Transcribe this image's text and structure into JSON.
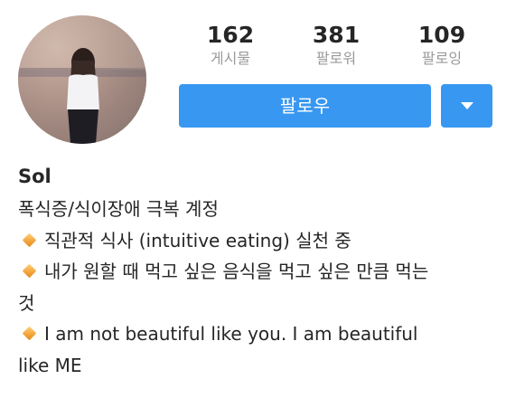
{
  "stats": [
    {
      "value": "162",
      "label": "게시물"
    },
    {
      "value": "381",
      "label": "팔로워"
    },
    {
      "value": "109",
      "label": "팔로잉"
    }
  ],
  "follow_button": "팔로우",
  "profile": {
    "name": "Sol",
    "bio_lines": [
      {
        "text": "폭식증/식이장애 극복 계정",
        "bullet": false
      },
      {
        "text": "직관적 식사 (intuitive eating) 실천 중",
        "bullet": true
      },
      {
        "text": "내가 원할 때 먹고 싶은 음식을 먹고 싶은 만큼 먹는",
        "bullet": true
      },
      {
        "text": "것",
        "bullet": false
      },
      {
        "text": "I am not beautiful like you. I am beautiful",
        "bullet": true
      },
      {
        "text": "like ME",
        "bullet": false
      }
    ]
  },
  "icons": {
    "bullet": "orange-diamond-icon",
    "dropdown": "chevron-down-icon"
  },
  "colors": {
    "accent": "#3897f0",
    "stat_label": "#9a9a9a",
    "bullet": "#f2a33a"
  }
}
